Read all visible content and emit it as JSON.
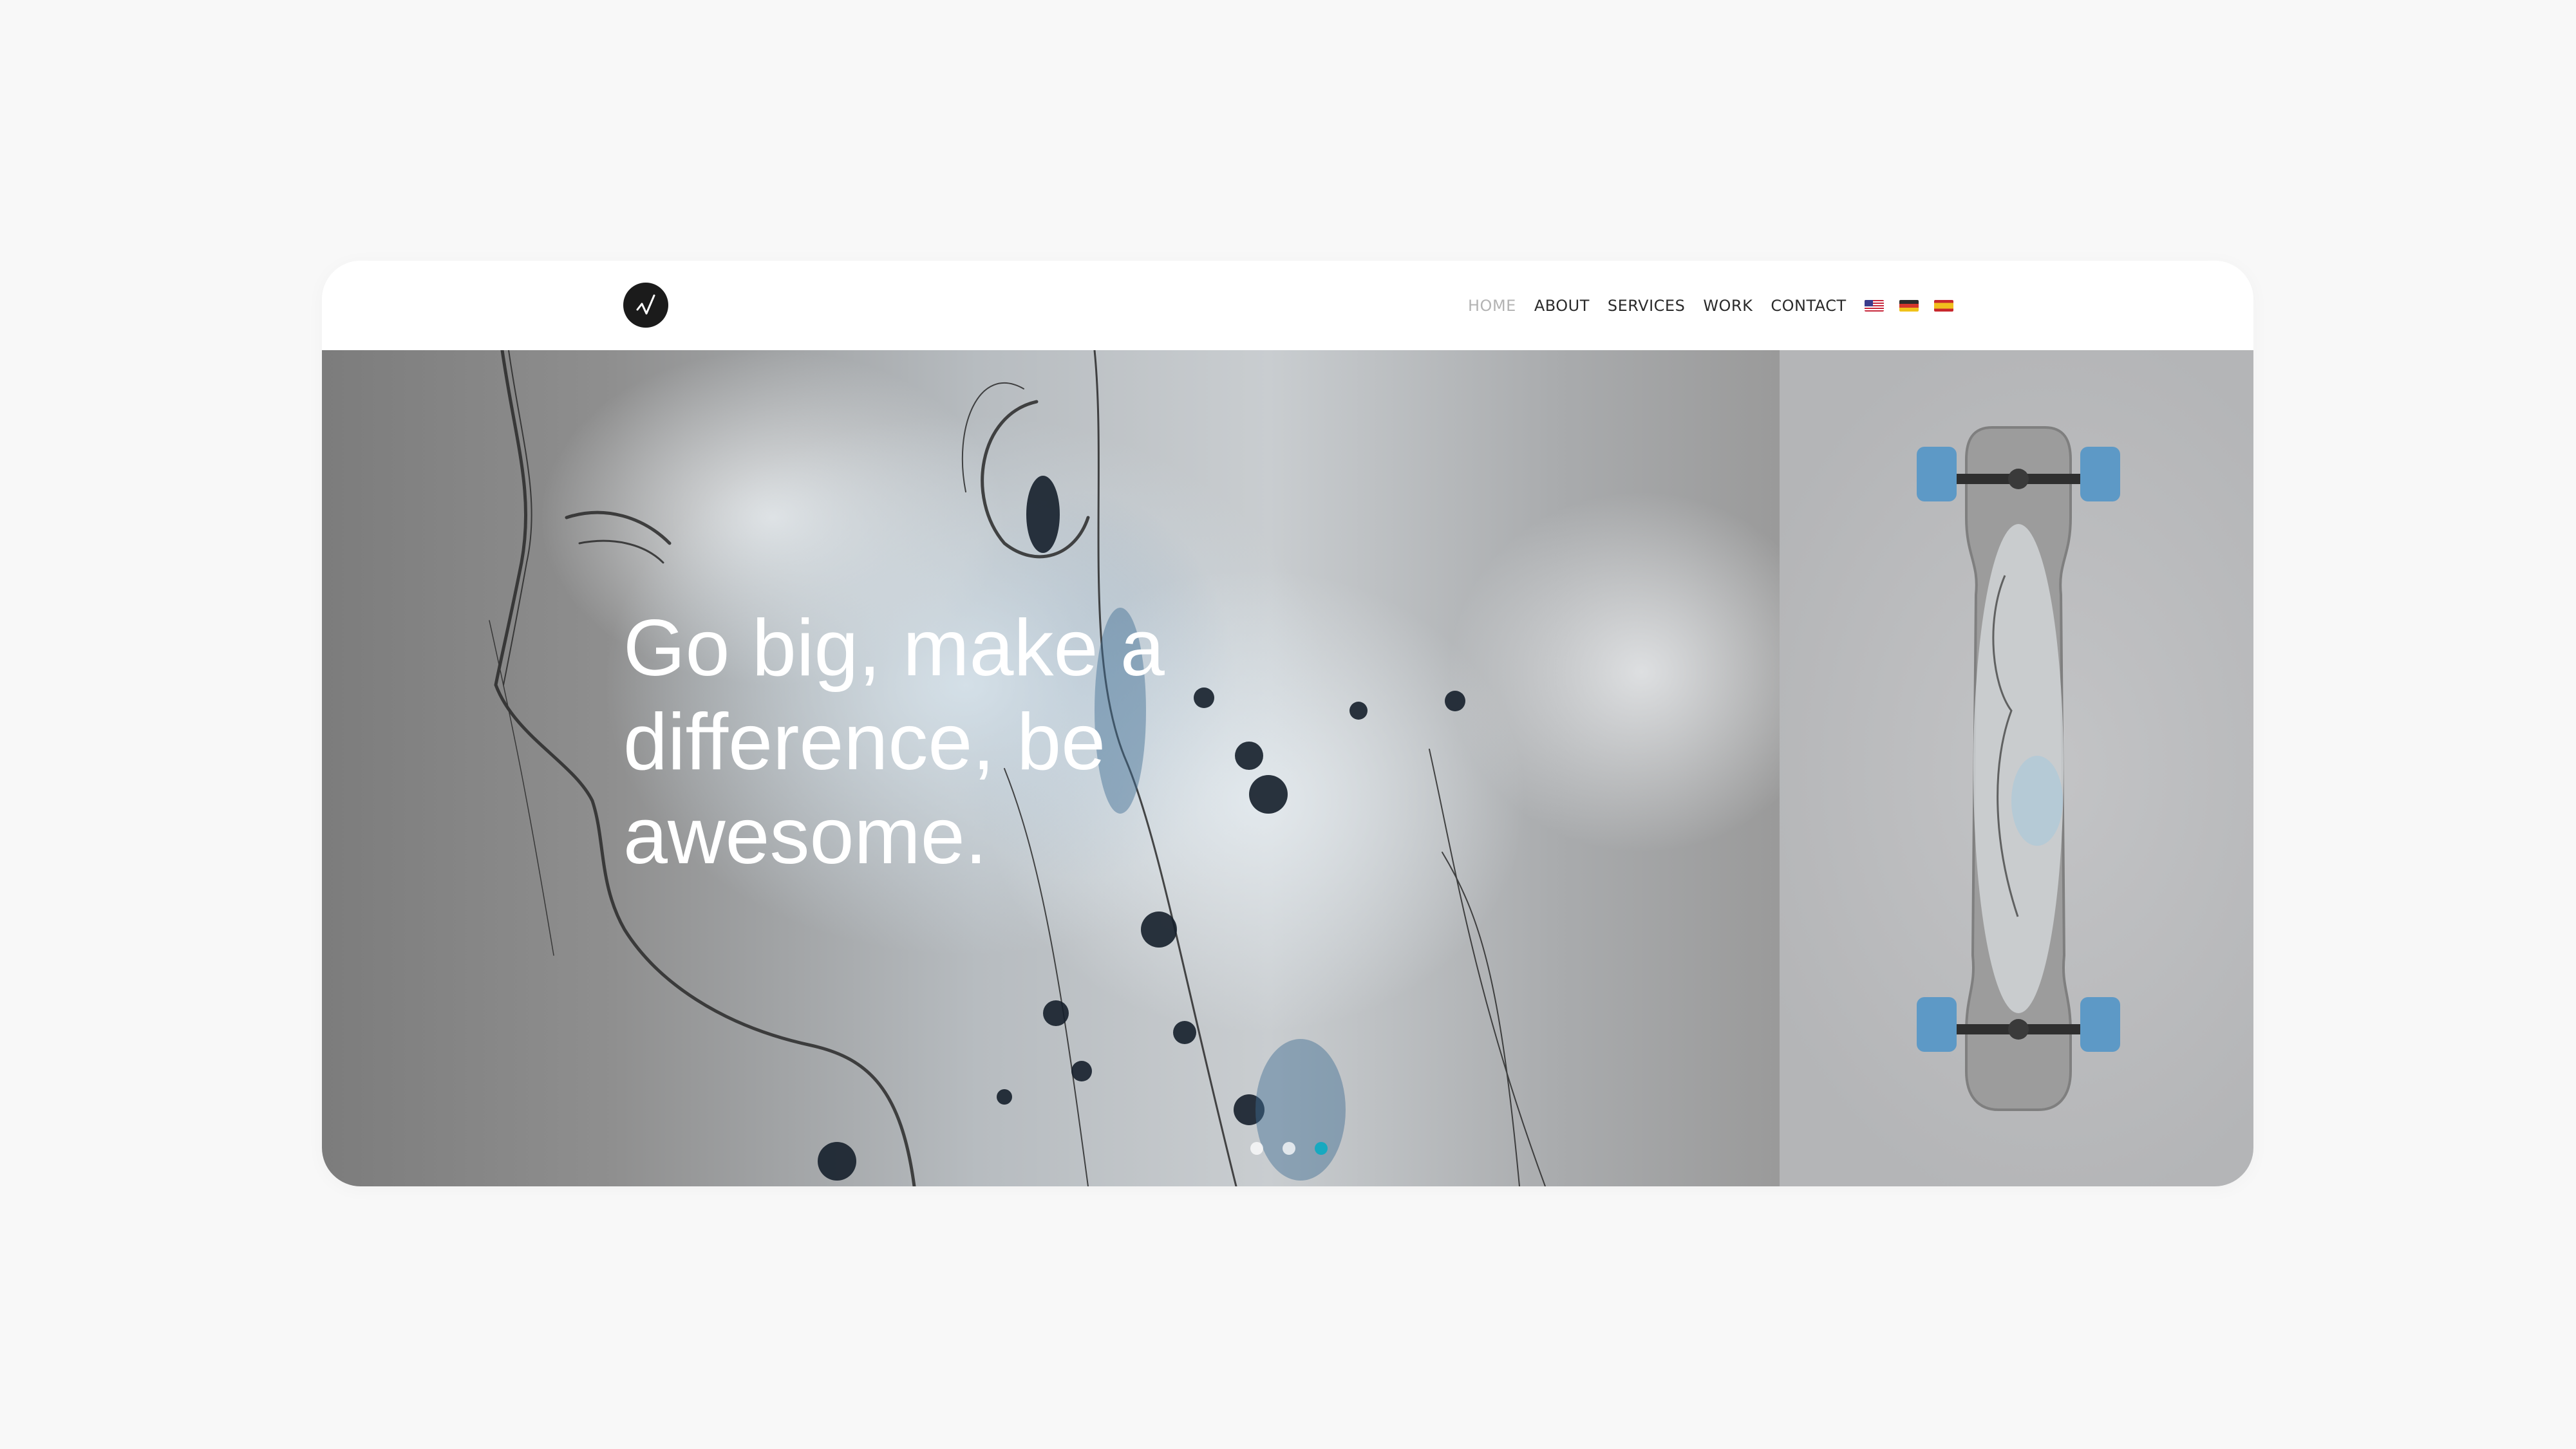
{
  "nav": {
    "items": [
      {
        "label": "HOME",
        "active": true
      },
      {
        "label": "ABOUT",
        "active": false
      },
      {
        "label": "SERVICES",
        "active": false
      },
      {
        "label": "WORK",
        "active": false
      },
      {
        "label": "CONTACT",
        "active": false
      }
    ],
    "languages": [
      {
        "icon": "us-flag-icon"
      },
      {
        "icon": "de-flag-icon"
      },
      {
        "icon": "es-flag-icon"
      }
    ]
  },
  "logo": {
    "icon": "checkmark-logo-icon"
  },
  "hero": {
    "headline": "Go big, make a difference, be awesome.",
    "slides": {
      "count": 3,
      "active_index": 2
    }
  },
  "colors": {
    "accent": "#17a9c0",
    "logo_bg": "#1b1b1b",
    "nav_text": "#2a2a2a",
    "nav_active": "#b3b3b3",
    "page_bg": "#f8f8f8"
  }
}
